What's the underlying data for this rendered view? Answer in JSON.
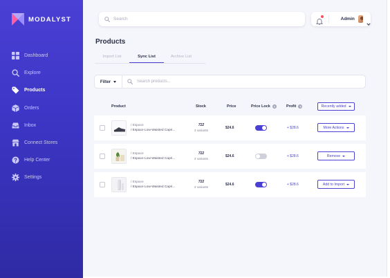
{
  "brand": {
    "name": "MODALYST"
  },
  "nav": [
    {
      "label": "Dashboard",
      "icon": "dashboard-icon",
      "active": false
    },
    {
      "label": "Explore",
      "icon": "search-icon",
      "active": false
    },
    {
      "label": "Products",
      "icon": "tag-icon",
      "active": true
    },
    {
      "label": "Orders",
      "icon": "box-icon",
      "active": false
    },
    {
      "label": "Inbox",
      "icon": "inbox-icon",
      "active": false
    },
    {
      "label": "Connect Stores",
      "icon": "store-icon",
      "active": false
    },
    {
      "label": "Help Center",
      "icon": "help-icon",
      "active": false
    },
    {
      "label": "Settings",
      "icon": "gear-icon",
      "active": false
    }
  ],
  "topbar": {
    "search_placeholder": "Search",
    "user_name": "Admin"
  },
  "page": {
    "title": "Products",
    "tabs": [
      {
        "label": "Import List",
        "active": false
      },
      {
        "label": "Sync List",
        "active": true
      },
      {
        "label": "Archive List",
        "active": false
      }
    ]
  },
  "filter": {
    "label": "Filter",
    "search_placeholder": "Search products..."
  },
  "table": {
    "headers": {
      "product": "Product",
      "stock": "Stock",
      "price": "Price",
      "price_lock": "Price Lock",
      "profit": "Profit",
      "help_glyph": "?"
    },
    "sort_label": "Recently added",
    "rows": [
      {
        "brand": "/ Espace",
        "title": "/ Espace Low-Waisted Capri...",
        "stock": "722",
        "variants": "2 variants",
        "price": "$24.6",
        "price_lock": true,
        "profit": "+ $28.6",
        "action": "More Actions"
      },
      {
        "brand": "/ Espace",
        "title": "/ Espace Low-Waisted Capri...",
        "stock": "722",
        "variants": "2 variants",
        "price": "$24.6",
        "price_lock": false,
        "profit": "+ $28.6",
        "action": "Remove"
      },
      {
        "brand": "/ Espace",
        "title": "/ Espace Low-Waisted Capri...",
        "stock": "722",
        "variants": "2 variants",
        "price": "$24.6",
        "price_lock": true,
        "profit": "+ $28.6",
        "action": "Add to Import"
      }
    ]
  },
  "colors": {
    "accent": "#4a40d4",
    "sidebar_top": "#4a40d4",
    "sidebar_bottom": "#2f2aa4",
    "notification": "#ff4d5e"
  }
}
